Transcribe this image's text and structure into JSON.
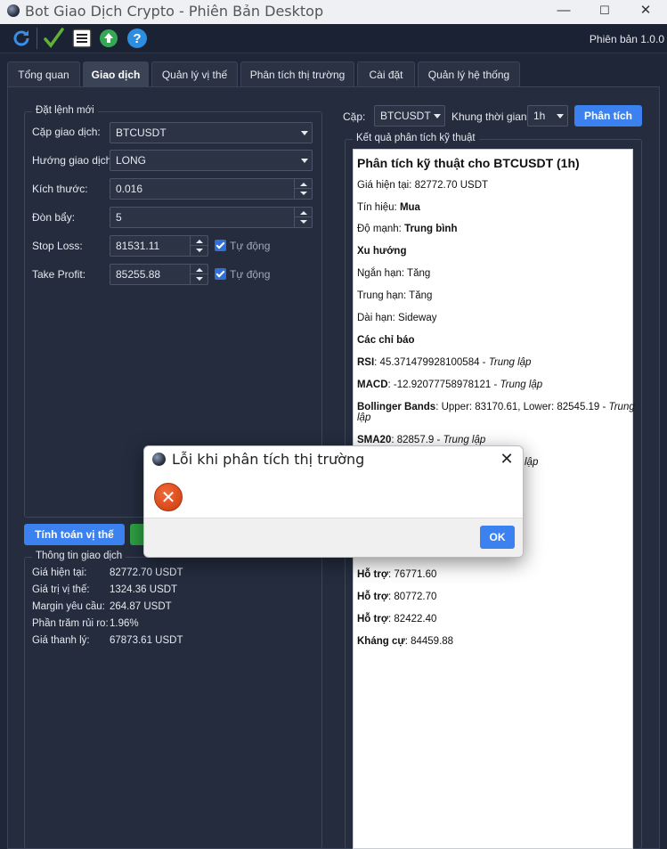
{
  "window": {
    "title": "Bot Giao Dịch Crypto - Phiên Bản Desktop",
    "minimize": "—",
    "maximize": "☐",
    "close": "✕"
  },
  "toolbar": {
    "version": "Phiên bản 1.0.0",
    "icons": [
      "refresh-icon",
      "check-icon",
      "list-icon",
      "upload-icon",
      "help-icon"
    ]
  },
  "tabs": [
    {
      "label": "Tổng quan"
    },
    {
      "label": "Giao dịch"
    },
    {
      "label": "Quản lý vị thế"
    },
    {
      "label": "Phân tích thị trường"
    },
    {
      "label": "Cài đặt"
    },
    {
      "label": "Quản lý hệ thống"
    }
  ],
  "order": {
    "group_title": "Đặt lệnh mới",
    "pair_label": "Cặp giao dịch:",
    "pair_value": "BTCUSDT",
    "direction_label": "Hướng giao dịch:",
    "direction_value": "LONG",
    "size_label": "Kích thước:",
    "size_value": "0.016",
    "leverage_label": "Đòn bẩy:",
    "leverage_value": "5",
    "stoploss_label": "Stop Loss:",
    "stoploss_value": "81531.11",
    "stoploss_auto": "Tự động",
    "takeprofit_label": "Take Profit:",
    "takeprofit_value": "85255.88",
    "takeprofit_auto": "Tự động",
    "calc_button": "Tính toán vị thế"
  },
  "trade_info": {
    "group_title": "Thông tin giao dịch",
    "rows": [
      {
        "label": "Giá hiện tại:",
        "value": "82772.70 USDT"
      },
      {
        "label": "Giá trị vị thế:",
        "value": "1324.36 USDT"
      },
      {
        "label": "Margin yêu cầu:",
        "value": "264.87 USDT"
      },
      {
        "label": "Phần trăm rủi ro:",
        "value": "1.96%"
      },
      {
        "label": "Giá thanh lý:",
        "value": "67873.61 USDT"
      }
    ]
  },
  "analysis": {
    "pair_label": "Cặp:",
    "pair_value": "BTCUSDT",
    "timeframe_label": "Khung thời gian:",
    "timeframe_value": "1h",
    "analyze_button": "Phân tích",
    "group_title": "Kết quả phân tích kỹ thuật",
    "title": "Phân tích kỹ thuật cho BTCUSDT (1h)",
    "price_label": "Giá hiện tại: 82772.70 USDT",
    "signal_label": "Tín hiệu: ",
    "signal_value": "Mua",
    "strength_label": "Độ mạnh: ",
    "strength_value": "Trung bình",
    "trend_head": "Xu hướng",
    "short_term": "Ngắn hạn: Tăng",
    "mid_term": "Trung hạn: Tăng",
    "long_term": "Dài hạn: Sideway",
    "indicators_head": "Các chỉ báo",
    "rsi_name": "RSI",
    "rsi_value": ": 45.371479928100584 - ",
    "rsi_status": "Trung lập",
    "macd_name": "MACD",
    "macd_value": ": -12.92077758978121 - ",
    "macd_status": "Trung lập",
    "bb_name": "Bollinger Bands",
    "bb_value": ": Upper: 83170.61, Lower: 82545.19 - ",
    "bb_status": "Trung",
    "bb_status2": "lập",
    "sma_name": "SMA20",
    "sma_value": ": 82857.9 - ",
    "sma_status": "Trung lập",
    "hidden_status": "lập",
    "support_label": "Hỗ trợ",
    "support1": ": 76771.60",
    "support2": ": 80772.70",
    "support3": ": 82422.40",
    "resistance_label": "Kháng cự",
    "resistance1": ": 84459.88"
  },
  "dialog": {
    "title": "Lỗi khi phân tích thị trường",
    "close": "✕",
    "error_glyph": "✕",
    "ok": "OK"
  },
  "colors": {
    "accent": "#3b82f0",
    "background": "#1f2638",
    "error": "#d9471a",
    "check_green": "#2ea043"
  }
}
